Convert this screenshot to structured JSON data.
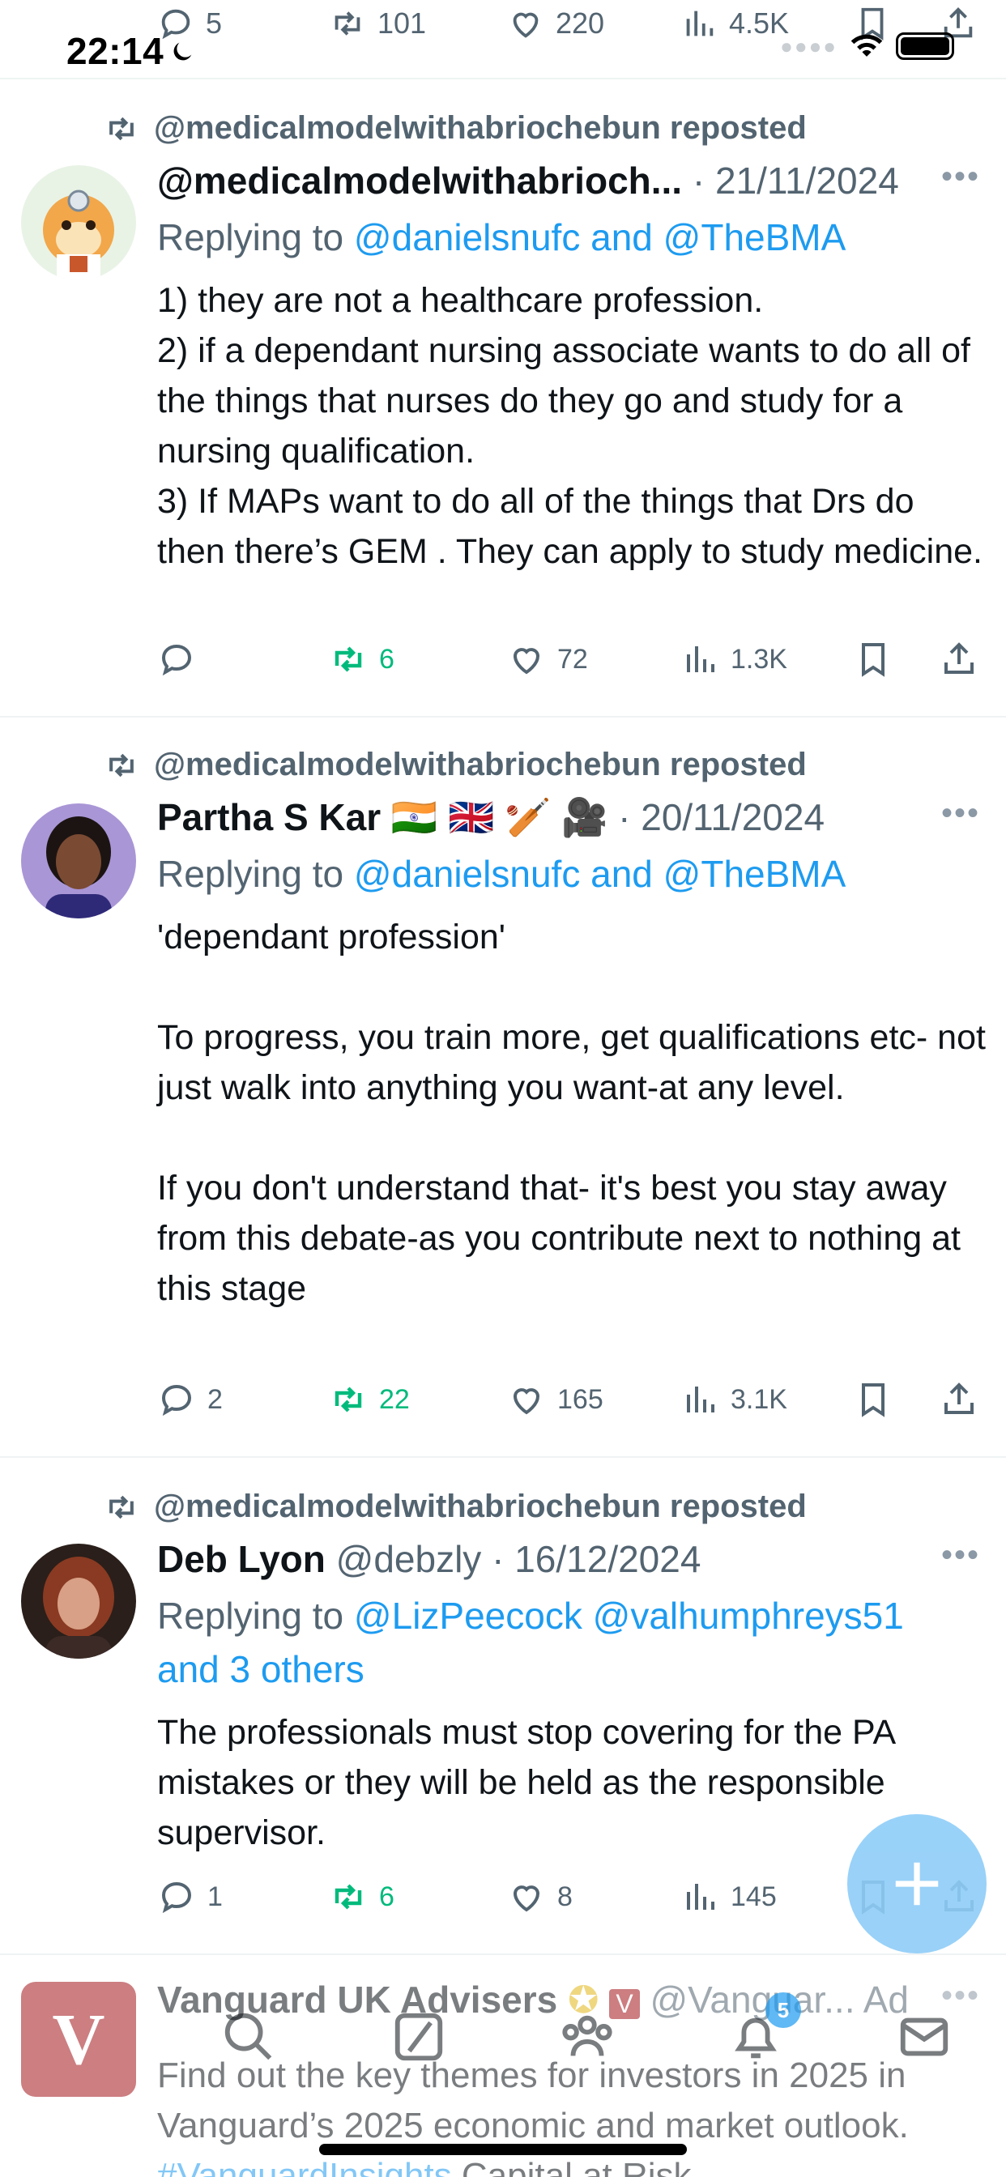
{
  "top_actions": {
    "reply_count": "5",
    "repost_count": "101",
    "like_count": "220",
    "view_count": "4.5K"
  },
  "status_bar": {
    "time": "22:14"
  },
  "tweets": [
    {
      "repost_label": "@medicalmodelwithabriochebun reposted",
      "name": "@medicalmodelwithabrioch...",
      "handle": "",
      "date": "21/11/2024",
      "reply_prefix": "Replying to ",
      "reply_mentions": "@danielsnufc and @TheBMA",
      "text": "1) they are not a healthcare profession.\n2) if a dependant nursing associate wants to do all of the things that nurses do they go and study for a nursing qualification.\n3) If MAPs want to do all of the things that Drs do then there’s GEM . They can apply to study medicine.",
      "replies": "",
      "reposts": "6",
      "likes": "72",
      "views": "1.3K"
    },
    {
      "repost_label": "@medicalmodelwithabriochebun reposted",
      "name": "Partha S Kar 🇮🇳 🇬🇧 🏏 🎥",
      "handle": "",
      "date": "20/11/2024",
      "reply_prefix": "Replying to ",
      "reply_mentions": "@danielsnufc and @TheBMA",
      "text": "'dependant profession'\n\nTo progress, you train more, get qualifications etc- not just walk into anything you want-at any level.\n\nIf you don't understand that- it's best you stay away from this debate-as you contribute next to nothing at this stage",
      "replies": "2",
      "reposts": "22",
      "likes": "165",
      "views": "3.1K"
    },
    {
      "repost_label": "@medicalmodelwithabriochebun reposted",
      "name": "Deb Lyon",
      "handle": "@debzly",
      "date": "16/12/2024",
      "reply_prefix": "Replying to ",
      "reply_mentions": "@LizPeecock @valhumphreys51 and 3 others",
      "text": "The professionals must stop covering for the PA mistakes or they will be held as the responsible supervisor.",
      "replies": "1",
      "reposts": "6",
      "likes": "8",
      "views": "145"
    }
  ],
  "ad": {
    "name": "Vanguard UK Advisers",
    "handle": "@Vanguar...",
    "label": "Ad",
    "text_start": "Find out the key themes for investors in 2025 in Vanguard’s 2025 economic and market outlook. ",
    "hashtag": "#VanguardInsights",
    "text_end": " Capital at Risk."
  },
  "nav": {
    "notification_count": "5"
  },
  "icons": [
    "reply-icon",
    "repost-icon",
    "like-icon",
    "views-icon",
    "bookmark-icon",
    "share-icon",
    "more-icon",
    "search-icon",
    "communities-icon",
    "notifications-icon",
    "messages-icon",
    "home-icon",
    "compose-icon"
  ],
  "colors": {
    "accent": "#1d9bf0",
    "repost_green": "#00ba7c",
    "secondary_text": "#536471"
  }
}
